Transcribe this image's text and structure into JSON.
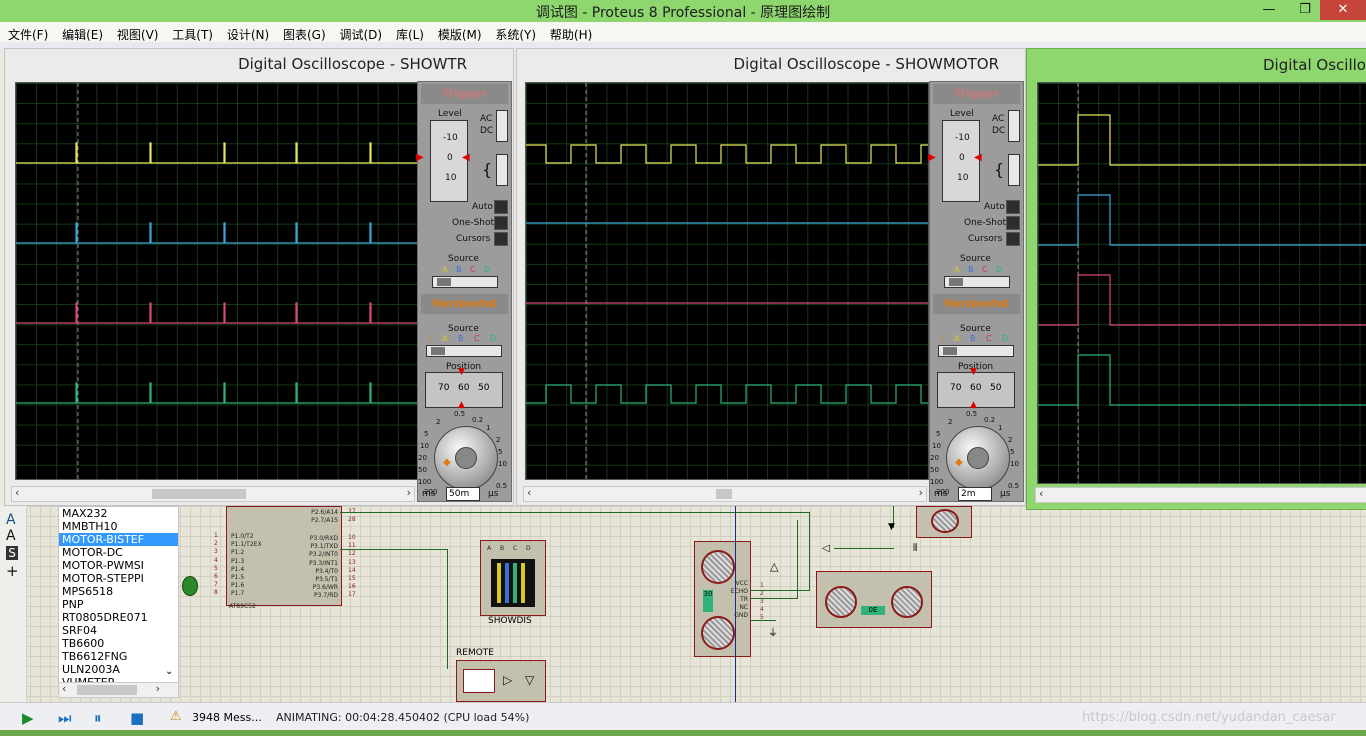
{
  "app": {
    "title": "调试图 - Proteus 8 Professional - 原理图绘制",
    "window_controls": {
      "minimize": "—",
      "restore": "❐",
      "close": "✕"
    }
  },
  "menu": [
    "文件(F)",
    "编辑(E)",
    "视图(V)",
    "工具(T)",
    "设计(N)",
    "图表(G)",
    "调试(D)",
    "库(L)",
    "模版(M)",
    "系统(Y)",
    "帮助(H)"
  ],
  "oscilloscopes": [
    {
      "title": "Digital Oscilloscope - SHOWTR",
      "trigger": {
        "header": "Trigger",
        "level_label": "Level",
        "level_ticks": [
          "-10",
          "0",
          "10"
        ],
        "ac": "AC",
        "dc": "DC",
        "auto": "Auto",
        "one_shot": "One-Shot",
        "cursors": "Cursors",
        "source": "Source",
        "channels": [
          "A",
          "B",
          "C",
          "D"
        ]
      },
      "horizontal": {
        "header": "Horizontal",
        "source": "Source",
        "position": "Position",
        "pos_ticks": [
          "70",
          "60",
          "50"
        ],
        "dial_ticks": [
          "0.5",
          "0.2",
          "1",
          "2",
          "5",
          "10",
          "20",
          "50",
          "100",
          "200"
        ],
        "unit_left": "ms",
        "timebase": "50m",
        "unit_right": "μs",
        "min_tick": "0.5"
      },
      "traces": {
        "yellow": "pulses",
        "blue": "pulses",
        "pink": "pulses",
        "green": "pulses"
      }
    },
    {
      "title": "Digital Oscilloscope - SHOWMOTOR",
      "trigger": {
        "header": "Trigger",
        "level_label": "Level",
        "level_ticks": [
          "-10",
          "0",
          "10"
        ],
        "ac": "AC",
        "dc": "DC",
        "auto": "Auto",
        "one_shot": "One-Shot",
        "cursors": "Cursors",
        "source": "Source",
        "channels": [
          "A",
          "B",
          "C",
          "D"
        ]
      },
      "horizontal": {
        "header": "Horizontal",
        "source": "Source",
        "position": "Position",
        "pos_ticks": [
          "70",
          "60",
          "50"
        ],
        "dial_ticks": [
          "0.5",
          "0.2",
          "1",
          "2",
          "5",
          "10",
          "20",
          "50",
          "100",
          "200"
        ],
        "unit_left": "ms",
        "timebase": "2m",
        "unit_right": "μs",
        "min_tick": "0.5"
      },
      "traces": {
        "yellow": "square",
        "blue": "flat",
        "pink": "flat",
        "green": "square"
      }
    },
    {
      "title": "Digital Oscilloscope - SHOWDIS",
      "traces": {
        "yellow": "step",
        "blue": "step",
        "pink": "step",
        "green": "step"
      }
    }
  ],
  "trace_colors": {
    "yellow": "#e6e65c",
    "blue": "#3ca6d8",
    "pink": "#d84a7a",
    "green": "#2fb37a"
  },
  "device_list": [
    "MAX232",
    "MMBTH10",
    "MOTOR-BISTEF",
    "MOTOR-DC",
    "MOTOR-PWMSI",
    "MOTOR-STEPPI",
    "MPS6518",
    "PNP",
    "RT0805DRE071",
    "SRF04",
    "TB6600",
    "TB6612FNG",
    "ULN2003A",
    "VUMETER"
  ],
  "device_selected": "MOTOR-BISTEF",
  "left_tools": [
    "A",
    "A",
    "S",
    "+"
  ],
  "schematic": {
    "mcu_name": "AT89C52",
    "mcu_left_pins": [
      "P1.0/T2",
      "P1.1/T2EX",
      "P1.2",
      "P1.3",
      "P1.4",
      "P1.5",
      "P1.6",
      "P1.7"
    ],
    "mcu_left_nums": [
      "1",
      "2",
      "3",
      "4",
      "5",
      "6",
      "7",
      "8"
    ],
    "mcu_right_pins": [
      "P2.6/A14",
      "P2.7/A15",
      "P3.0/RXD",
      "P3.1/TXD",
      "P3.2/INT0",
      "P3.3/INT1",
      "P3.4/T0",
      "P3.5/T1",
      "P3.6/WR",
      "P3.7/RD"
    ],
    "mcu_right_nums": [
      "27",
      "28",
      "10",
      "11",
      "12",
      "13",
      "14",
      "15",
      "16",
      "17"
    ],
    "showdis_label": "SHOWDIS",
    "showdis_pins": [
      "A",
      "B",
      "C",
      "D"
    ],
    "remote_label": "REMOTE",
    "sensor_pins": [
      "VCC",
      "ECHO",
      "TR",
      "NC",
      "GND"
    ],
    "sensor_nums": [
      "1",
      "2",
      "3",
      "4",
      "5"
    ],
    "sensor_display": "30",
    "sensor2_display": "0E"
  },
  "status": {
    "messages": "3948 Mess...",
    "animating": "ANIMATING: 00:04:28.450402 (CPU load 54%)",
    "watermark": "https://blog.csdn.net/yudandan_caesar"
  }
}
